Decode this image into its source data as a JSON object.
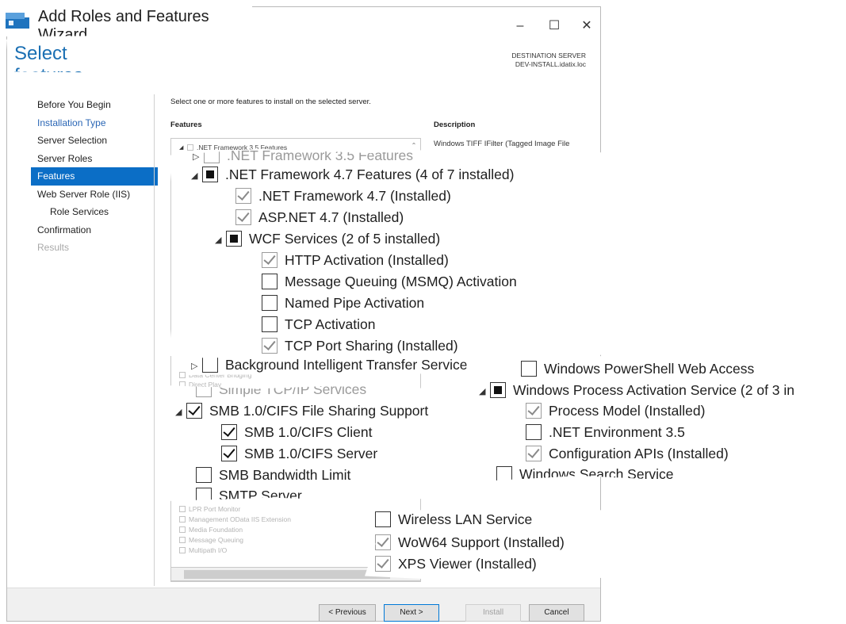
{
  "window": {
    "title": "Add Roles and Features Wizard",
    "controls": [
      "–",
      "☐",
      "✕"
    ]
  },
  "page_title": "Select features",
  "destination": {
    "label": "DESTINATION SERVER",
    "server": "DEV-INSTALL.idatix.loc"
  },
  "nav": {
    "items": [
      {
        "label": "Before You Begin"
      },
      {
        "label": "Installation Type"
      },
      {
        "label": "Server Selection"
      },
      {
        "label": "Server Roles"
      },
      {
        "label": "Features"
      },
      {
        "label": "Web Server Role (IIS)"
      },
      {
        "label": "Role Services"
      },
      {
        "label": "Confirmation"
      },
      {
        "label": "Results"
      }
    ]
  },
  "main": {
    "instruction": "Select one or more features to install on the selected server.",
    "features_header": "Features",
    "description_header": "Description",
    "description_text": "Windows TIFF IFilter (Tagged Image File Format... performs"
  },
  "small_list": {
    "top": ".NET Framework 3.5 Features",
    "items_mid": [
      "Data Center Bridging",
      "Direct Play"
    ],
    "items_bottom": [
      "LPR Port Monitor",
      "Management OData IIS Extension",
      "Media Foundation",
      "Message Queuing",
      "Multipath I/O"
    ]
  },
  "zoom_net": {
    "net35": ".NET Framework 3.5 Features",
    "net47": ".NET Framework 4.7 Features (4 of 7 installed)",
    "net47_core": ".NET Framework 4.7 (Installed)",
    "aspnet": "ASP.NET 4.7 (Installed)",
    "wcf": "WCF Services (2 of 5 installed)",
    "http_act": "HTTP Activation (Installed)",
    "msmq_act": "Message Queuing (MSMQ) Activation",
    "pipe_act": "Named Pipe Activation",
    "tcp_act": "TCP Activation",
    "tcp_share": "TCP Port Sharing (Installed)",
    "bits": "Background Intelligent Transfer Service"
  },
  "zoom_smb": {
    "tcpip": "Simple TCP/IP Services",
    "smb": "SMB 1.0/CIFS File Sharing Support",
    "client": "SMB 1.0/CIFS Client",
    "server": "SMB 1.0/CIFS Server",
    "bandwidth": "SMB Bandwidth Limit",
    "smtp": "SMTP Server"
  },
  "zoom_was": {
    "ps_web": "Windows PowerShell Web Access",
    "was": "Windows Process Activation Service (2 of 3 in",
    "process_model": "Process Model (Installed)",
    "net_env": ".NET Environment 3.5",
    "config_apis": "Configuration APIs (Installed)",
    "search": "Windows Search Service"
  },
  "zoom_wow": {
    "wlan": "Wireless LAN Service",
    "wow64": "WoW64 Support (Installed)",
    "xps": "XPS Viewer (Installed)"
  },
  "buttons": {
    "previous": "< Previous",
    "next": "Next >",
    "install": "Install",
    "cancel": "Cancel"
  }
}
